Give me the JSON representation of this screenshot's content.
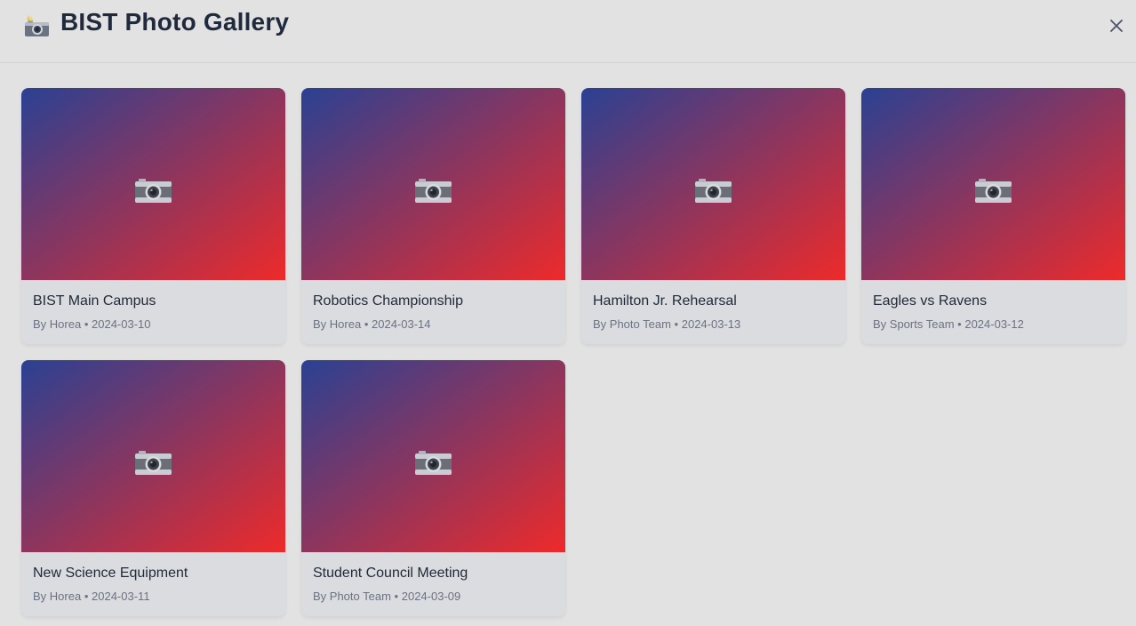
{
  "header": {
    "title": "BIST Photo Gallery",
    "icon": "camera-with-flash-icon",
    "close_icon": "close-icon"
  },
  "colors": {
    "background": "#e2e2e2",
    "card": "#dbdcdf",
    "gradient_start": "#2a4193",
    "gradient_end": "#ee2a2a"
  },
  "photos": [
    {
      "title": "BIST Main Campus",
      "author": "By Horea",
      "separator": "•",
      "date": "2024-03-10",
      "icon": "camera-icon"
    },
    {
      "title": "Robotics Championship",
      "author": "By Horea",
      "separator": "•",
      "date": "2024-03-14",
      "icon": "camera-icon"
    },
    {
      "title": "Hamilton Jr. Rehearsal",
      "author": "By Photo Team",
      "separator": "•",
      "date": "2024-03-13",
      "icon": "camera-icon"
    },
    {
      "title": "Eagles vs Ravens",
      "author": "By Sports Team",
      "separator": "•",
      "date": "2024-03-12",
      "icon": "camera-icon"
    },
    {
      "title": "New Science Equipment",
      "author": "By Horea",
      "separator": "•",
      "date": "2024-03-11",
      "icon": "camera-icon"
    },
    {
      "title": "Student Council Meeting",
      "author": "By Photo Team",
      "separator": "•",
      "date": "2024-03-09",
      "icon": "camera-icon"
    }
  ]
}
